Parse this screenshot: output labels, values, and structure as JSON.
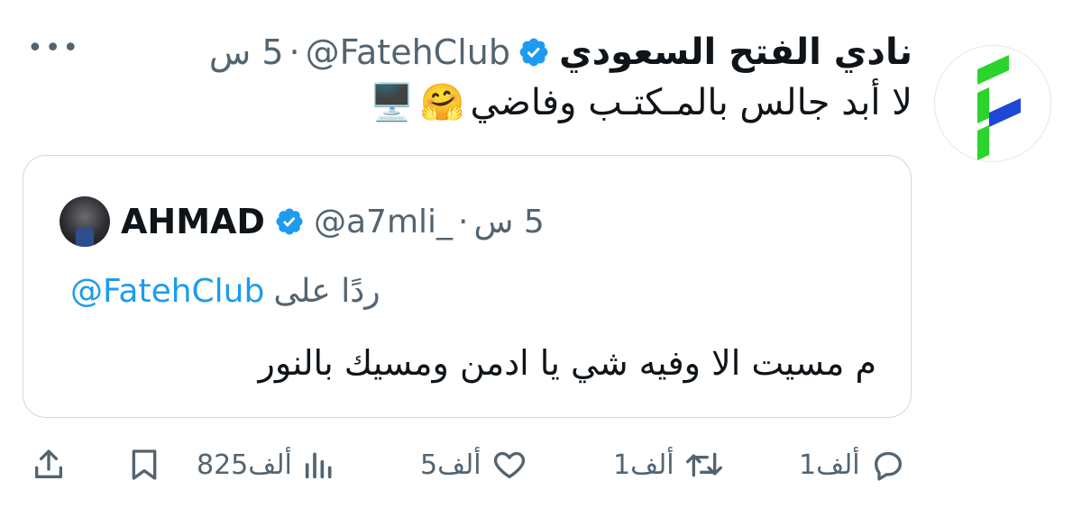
{
  "tweet": {
    "display_name": "نادي الفتح السعودي",
    "handle": "@FatehClub",
    "separator": "·",
    "time": "5 س",
    "text": "لا أبد جالس بالمـكتـب وفاضي",
    "emojis": [
      "🤗",
      "🖥️"
    ]
  },
  "quote": {
    "name": "AHMAD",
    "handle": "@a7mli_",
    "separator": "·",
    "time": "5 س",
    "reply_prefix": "ردًا على",
    "reply_to": "@FatehClub",
    "text": "م مسيت الا وفيه شي يا ادمن ومسيك بالنور"
  },
  "actions": {
    "replies": "1ألف",
    "retweets": "1ألف",
    "likes": "5ألف",
    "views": "825ألف"
  },
  "colors": {
    "verified": "#1d9bf0",
    "link": "#1d9bf0",
    "muted": "#536471",
    "logo_green": "#2bd42b",
    "logo_blue": "#1f47d6"
  },
  "icons": [
    "more-icon",
    "verified-icon",
    "reply-icon",
    "retweet-icon",
    "like-icon",
    "views-icon",
    "bookmark-icon",
    "share-icon"
  ]
}
